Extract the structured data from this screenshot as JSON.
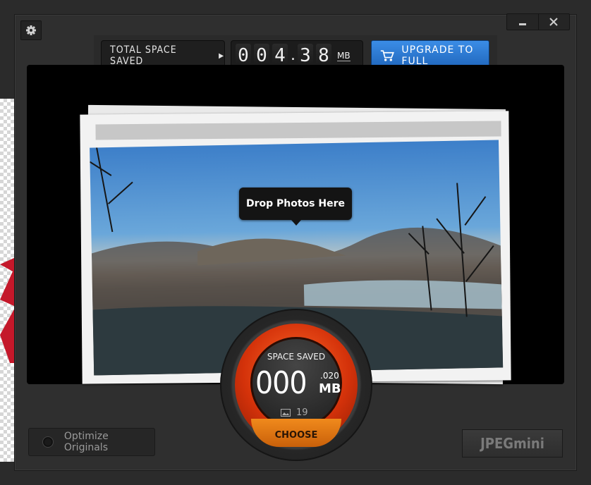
{
  "toolbar": {
    "total_space_label": "TOTAL SPACE SAVED",
    "counter_digits": [
      "0",
      "0",
      "4",
      "3",
      "8"
    ],
    "counter_unit": "MB",
    "upgrade_label": "UPGRADE TO FULL"
  },
  "drop_zone": {
    "tooltip": "Drop Photos Here"
  },
  "dial": {
    "space_saved_label": "SPACE SAVED",
    "big_value": "000",
    "decimal_value": ".020",
    "unit": "MB",
    "photo_count": "19",
    "choose_label": "CHOOSE"
  },
  "footer": {
    "optimize_label": "Optimize Originals",
    "logo_text": "JPEGmini"
  },
  "icons": {
    "settings": "gear-icon",
    "minimize": "minimize-icon",
    "close": "close-icon",
    "cart": "cart-icon",
    "play": "play-icon",
    "image": "image-icon"
  }
}
